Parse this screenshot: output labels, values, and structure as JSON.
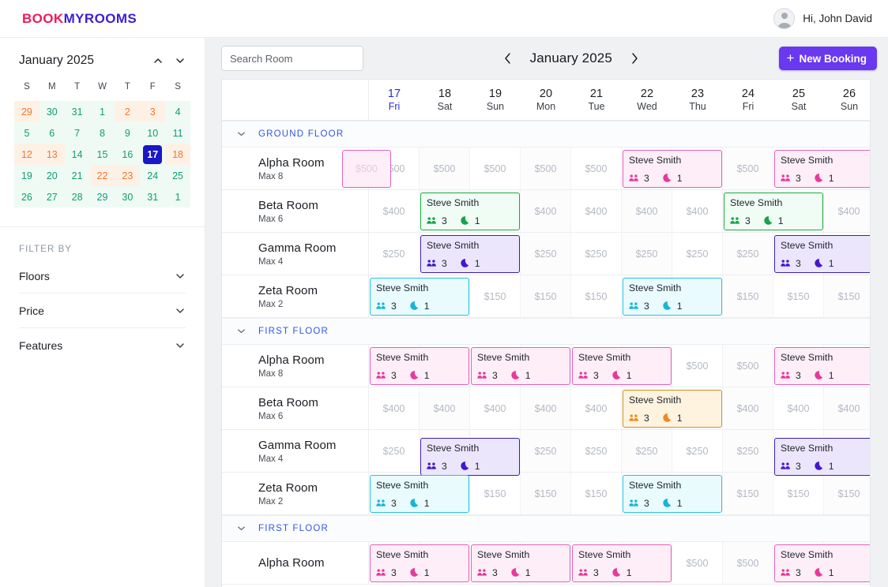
{
  "app": {
    "logo_first": "BOOK",
    "logo_second": "MYROOMS",
    "greeting": "Hi, John David"
  },
  "sidebar": {
    "calendar": {
      "title": "January 2025",
      "dow": [
        "S",
        "M",
        "T",
        "W",
        "T",
        "F",
        "S"
      ],
      "weeks": [
        [
          {
            "d": "29",
            "weekend": true
          },
          {
            "d": "30",
            "weekend": false
          },
          {
            "d": "31",
            "weekend": false
          },
          {
            "d": "1",
            "weekend": false
          },
          {
            "d": "2",
            "weekend": true
          },
          {
            "d": "3",
            "weekend": true
          },
          {
            "d": "4",
            "weekend": false
          }
        ],
        [
          {
            "d": "5",
            "weekend": false
          },
          {
            "d": "6",
            "weekend": false
          },
          {
            "d": "7",
            "weekend": false
          },
          {
            "d": "8",
            "weekend": false
          },
          {
            "d": "9",
            "weekend": false
          },
          {
            "d": "10",
            "weekend": false
          },
          {
            "d": "11",
            "weekend": false
          }
        ],
        [
          {
            "d": "12",
            "weekend": true
          },
          {
            "d": "13",
            "weekend": true
          },
          {
            "d": "14",
            "weekend": false
          },
          {
            "d": "15",
            "weekend": false
          },
          {
            "d": "16",
            "weekend": false
          },
          {
            "d": "17",
            "weekend": false,
            "today": true
          },
          {
            "d": "18",
            "weekend": true
          }
        ],
        [
          {
            "d": "19",
            "weekend": false
          },
          {
            "d": "20",
            "weekend": false
          },
          {
            "d": "21",
            "weekend": false
          },
          {
            "d": "22",
            "weekend": true
          },
          {
            "d": "23",
            "weekend": true
          },
          {
            "d": "24",
            "weekend": false
          },
          {
            "d": "25",
            "weekend": false
          }
        ],
        [
          {
            "d": "26",
            "weekend": false
          },
          {
            "d": "27",
            "weekend": false
          },
          {
            "d": "28",
            "weekend": false
          },
          {
            "d": "29",
            "weekend": false
          },
          {
            "d": "30",
            "weekend": false
          },
          {
            "d": "31",
            "weekend": false
          },
          {
            "d": "1",
            "weekend": false
          }
        ]
      ]
    },
    "filter_title": "FILTER BY",
    "filters": [
      {
        "label": "Floors"
      },
      {
        "label": "Price"
      },
      {
        "label": "Features"
      }
    ]
  },
  "toolbar": {
    "search_placeholder": "Search Room",
    "search_value": "",
    "month_label": "January 2025",
    "prev_icon": "chevron-left-icon",
    "next_icon": "chevron-right-icon",
    "new_booking_label": "New Booking",
    "new_booking_plus": "+",
    "accent_color": "#6938ef"
  },
  "grid": {
    "days": [
      {
        "num": "17",
        "dow": "Fri",
        "active": true
      },
      {
        "num": "18",
        "dow": "Sat",
        "active": false
      },
      {
        "num": "19",
        "dow": "Sun",
        "active": false
      },
      {
        "num": "20",
        "dow": "Mon",
        "active": false
      },
      {
        "num": "21",
        "dow": "Tue",
        "active": false
      },
      {
        "num": "22",
        "dow": "Wed",
        "active": false
      },
      {
        "num": "23",
        "dow": "Thu",
        "active": false
      },
      {
        "num": "24",
        "dow": "Fri",
        "active": false
      },
      {
        "num": "25",
        "dow": "Sat",
        "active": false
      },
      {
        "num": "26",
        "dow": "Sun",
        "active": false
      }
    ],
    "booking_name": "Steve Smith",
    "guests_count": "3",
    "nights_count": "1",
    "sections": [
      {
        "floor": "GROUND FLOOR",
        "rooms": [
          {
            "name": "Alpha Room",
            "max": "Max 8",
            "price": "$500",
            "bookings": [
              {
                "start": -0.55,
                "span": 1.0,
                "color": "pink",
                "empty": true,
                "label": "$500"
              },
              {
                "start": 5.0,
                "span": 2.0,
                "color": "pink",
                "empty": false
              },
              {
                "start": 8.0,
                "span": 2.1,
                "color": "pink",
                "empty": false
              }
            ]
          },
          {
            "name": "Beta Room",
            "max": "Max 6",
            "price": "$400",
            "bookings": [
              {
                "start": 1.0,
                "span": 2.0,
                "color": "green",
                "empty": false
              },
              {
                "start": 7.0,
                "span": 2.0,
                "color": "green",
                "empty": false
              }
            ]
          },
          {
            "name": "Gamma Room",
            "max": "Max 4",
            "price": "$250",
            "bookings": [
              {
                "start": 1.0,
                "span": 2.0,
                "color": "purple",
                "empty": false
              },
              {
                "start": 8.0,
                "span": 2.1,
                "color": "purple",
                "empty": false
              }
            ]
          },
          {
            "name": "Zeta Room",
            "max": "Max 2",
            "price": "$150",
            "bookings": [
              {
                "start": 0.0,
                "span": 2.0,
                "color": "cyan",
                "empty": false
              },
              {
                "start": 5.0,
                "span": 2.0,
                "color": "cyan",
                "empty": false
              }
            ]
          }
        ]
      },
      {
        "floor": "FIRST FLOOR",
        "rooms": [
          {
            "name": "Alpha Room",
            "max": "Max 8",
            "price": "$500",
            "bookings": [
              {
                "start": 0.0,
                "span": 2.0,
                "color": "pink",
                "empty": false
              },
              {
                "start": 2.0,
                "span": 2.0,
                "color": "pink",
                "empty": false
              },
              {
                "start": 4.0,
                "span": 2.0,
                "color": "pink",
                "empty": false
              },
              {
                "start": 8.0,
                "span": 2.1,
                "color": "pink",
                "empty": false
              }
            ]
          },
          {
            "name": "Beta Room",
            "max": "Max 6",
            "price": "$400",
            "bookings": [
              {
                "start": 5.0,
                "span": 2.0,
                "color": "amber",
                "empty": false
              }
            ]
          },
          {
            "name": "Gamma Room",
            "max": "Max 4",
            "price": "$250",
            "bookings": [
              {
                "start": 1.0,
                "span": 2.0,
                "color": "purple",
                "empty": false,
                "shift": true
              },
              {
                "start": 8.0,
                "span": 2.1,
                "color": "purple",
                "empty": false,
                "shift": true
              }
            ]
          },
          {
            "name": "Zeta Room",
            "max": "Max 2",
            "price": "$150",
            "bookings": [
              {
                "start": 0.0,
                "span": 2.0,
                "color": "cyan",
                "empty": false
              },
              {
                "start": 5.0,
                "span": 2.0,
                "color": "cyan",
                "empty": false
              }
            ]
          }
        ]
      },
      {
        "floor": "FIRST FLOOR",
        "rooms": [
          {
            "name": "Alpha Room",
            "max": "",
            "price": "$500",
            "bookings": [
              {
                "start": 0.0,
                "span": 2.0,
                "color": "pink",
                "empty": false
              },
              {
                "start": 2.0,
                "span": 2.0,
                "color": "pink",
                "empty": false
              },
              {
                "start": 4.0,
                "span": 2.0,
                "color": "pink",
                "empty": false
              },
              {
                "start": 8.0,
                "span": 2.1,
                "color": "pink",
                "empty": false
              }
            ]
          }
        ]
      }
    ],
    "colors": {
      "pink": {
        "bg": "#fdeef7",
        "border": "#e362b8",
        "icon": "#e8399b"
      },
      "green": {
        "bg": "#effdf4",
        "border": "#1fa83f",
        "icon": "#16a34a"
      },
      "purple": {
        "bg": "#ece6fd",
        "border": "#3a1fae",
        "icon": "#4318d1"
      },
      "cyan": {
        "bg": "#e9fbfd",
        "border": "#25c3e0",
        "icon": "#18b5d8"
      },
      "amber": {
        "bg": "#fef3df",
        "border": "#d09226",
        "icon": "#ef8a22"
      }
    }
  }
}
